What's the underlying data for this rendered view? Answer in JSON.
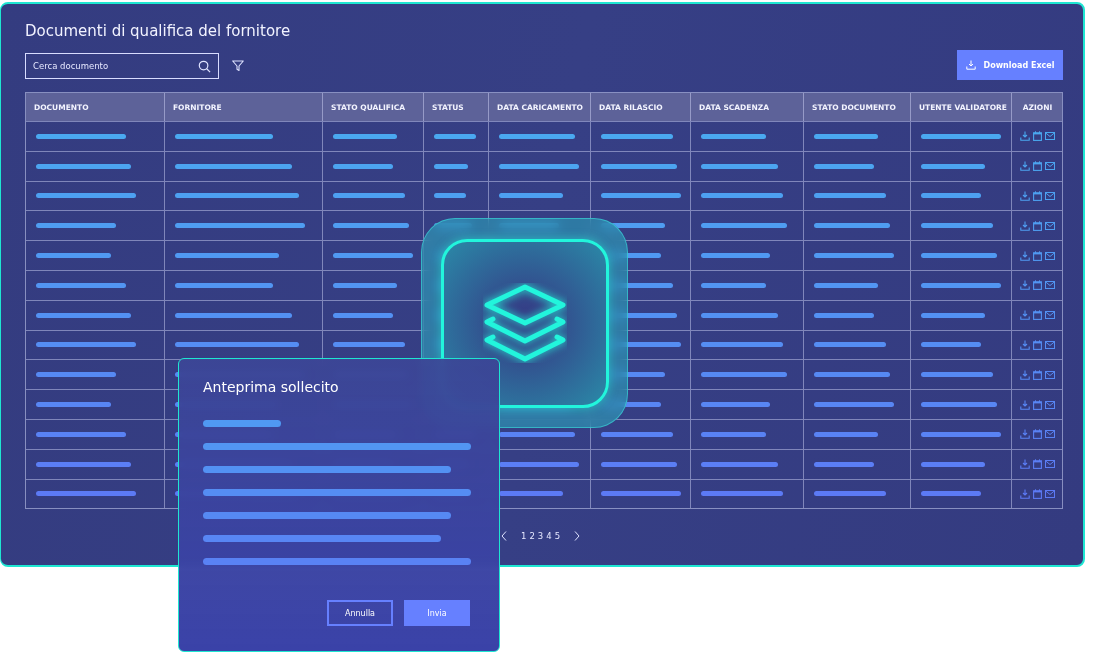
{
  "panel": {
    "title": "Documenti di qualifica del fornitore",
    "search": {
      "placeholder": "Cerca documento"
    },
    "download_button": "Download Excel"
  },
  "table": {
    "columns": [
      "DOCUMENTO",
      "FORNITORE",
      "STATO QUALIFICA",
      "STATUS",
      "DATA CARICAMENTO",
      "DATA RILASCIO",
      "DATA SCADENZA",
      "STATO DOCUMENTO",
      "UTENTE VALIDATORE",
      "AZIONI"
    ]
  },
  "pagination": {
    "pages": [
      "1",
      "2",
      "3",
      "4",
      "5"
    ]
  },
  "modal": {
    "title": "Anteprima sollecito",
    "buttons": [
      {
        "label": "Annulla",
        "kind": "secondary"
      },
      {
        "label": "Invia",
        "kind": "primary"
      }
    ]
  }
}
